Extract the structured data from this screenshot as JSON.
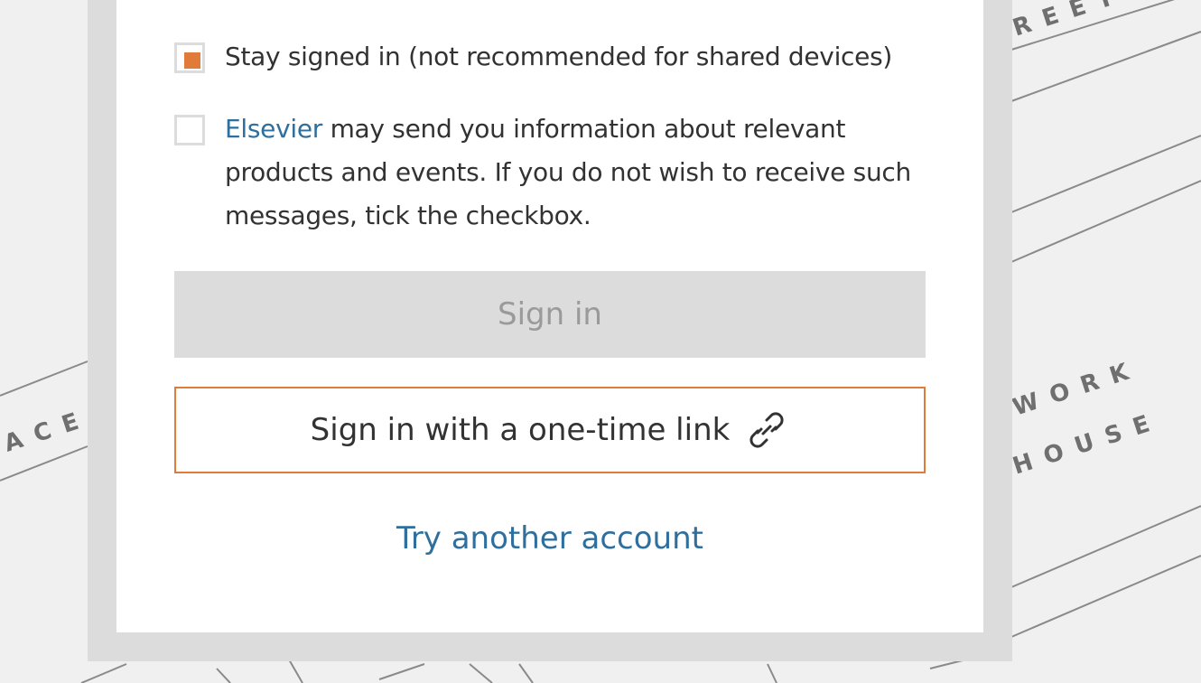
{
  "stay_signed_in": {
    "label": "Stay signed in (not recommended for shared devices)",
    "checked": true
  },
  "marketing": {
    "link_text": "Elsevier",
    "text": " may send you information about relevant products and events. If you do not wish to receive such messages, tick the checkbox.",
    "checked": false
  },
  "buttons": {
    "sign_in": "Sign in",
    "one_time_link": "Sign in with a one-time link"
  },
  "try_another": "Try another account",
  "icons": {
    "one_time_link": "link-icon"
  },
  "colors": {
    "accent": "#e07b39",
    "link": "#2e6f9e",
    "disabled": "#dcdcdc"
  }
}
